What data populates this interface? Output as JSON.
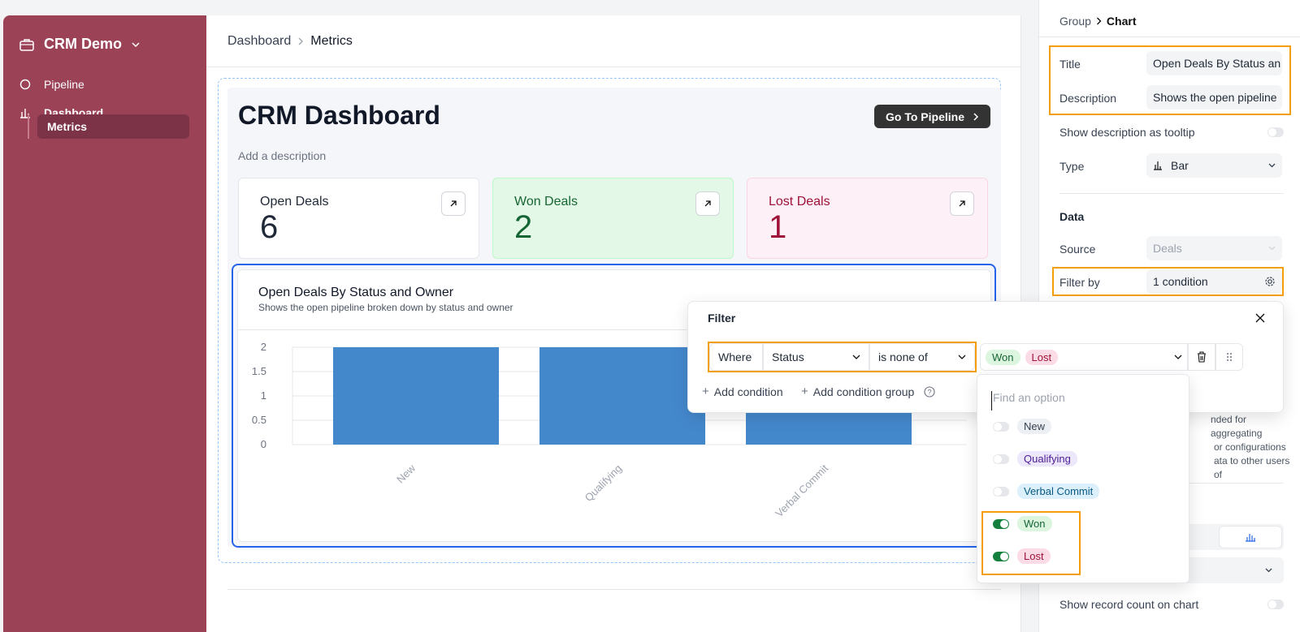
{
  "sidebar": {
    "app_name": "CRM Demo",
    "items": [
      {
        "label": "Pipeline",
        "icon": "circle-icon"
      },
      {
        "label": "Dashboard",
        "icon": "bar-chart-icon"
      },
      {
        "label": "Metrics"
      }
    ]
  },
  "breadcrumb": {
    "parent": "Dashboard",
    "current": "Metrics"
  },
  "dashboard": {
    "title": "CRM Dashboard",
    "description_placeholder": "Add a description",
    "goto_button": "Go To Pipeline"
  },
  "stats": [
    {
      "label": "Open Deals",
      "value": "6",
      "color": "#1f2937",
      "bg": "#ffffff"
    },
    {
      "label": "Won Deals",
      "value": "2",
      "color": "#166534",
      "bg": "#e3f8e6"
    },
    {
      "label": "Lost Deals",
      "value": "1",
      "color": "#9f1239",
      "bg": "#fdf0f6"
    }
  ],
  "chart": {
    "title": "Open Deals By Status and Owner",
    "subtitle": "Shows the open pipeline broken down by status and owner"
  },
  "chart_data": {
    "type": "bar",
    "title": "Open Deals By Status and Owner",
    "categories": [
      "New",
      "Qualifying",
      "Verbal Commit"
    ],
    "values": [
      2,
      2,
      2
    ],
    "ylim": [
      0,
      2
    ],
    "yticks": [
      "0",
      "0.5",
      "1",
      "1.5",
      "2"
    ],
    "grid": true,
    "bar_color": "#4488cc"
  },
  "panel": {
    "breadcrumb_parent": "Group",
    "breadcrumb_current": "Chart",
    "title_label": "Title",
    "title_value": "Open Deals By Status an",
    "description_label": "Description",
    "description_value": "Shows the open pipeline",
    "tooltip_label": "Show description as tooltip",
    "type_label": "Type",
    "type_value": "Bar",
    "data_heading": "Data",
    "source_label": "Source",
    "source_value": "Deals",
    "filter_label": "Filter by",
    "filter_value": "1 condition",
    "notice_line1": "nded for aggregating",
    "notice_line2": "or configurations",
    "notice_line3": "ata to other users of",
    "record_count_label": "Show record count on chart"
  },
  "filter": {
    "title": "Filter",
    "where": "Where",
    "field": "Status",
    "operator": "is none of",
    "selected": [
      "Won",
      "Lost"
    ],
    "add_condition": "Add condition",
    "add_group": "Add condition group",
    "search_placeholder": "Find an option",
    "options": [
      {
        "label": "New",
        "on": false,
        "bg": "#eceff3",
        "color": "#374151"
      },
      {
        "label": "Qualifying",
        "on": false,
        "bg": "#ede7fb",
        "color": "#4c1d95"
      },
      {
        "label": "Verbal Commit",
        "on": false,
        "bg": "#dcf0fb",
        "color": "#075985"
      },
      {
        "label": "Won",
        "on": true,
        "bg": "#dcf5df",
        "color": "#166534"
      },
      {
        "label": "Lost",
        "on": true,
        "bg": "#fbdbe5",
        "color": "#9f1239"
      }
    ]
  }
}
